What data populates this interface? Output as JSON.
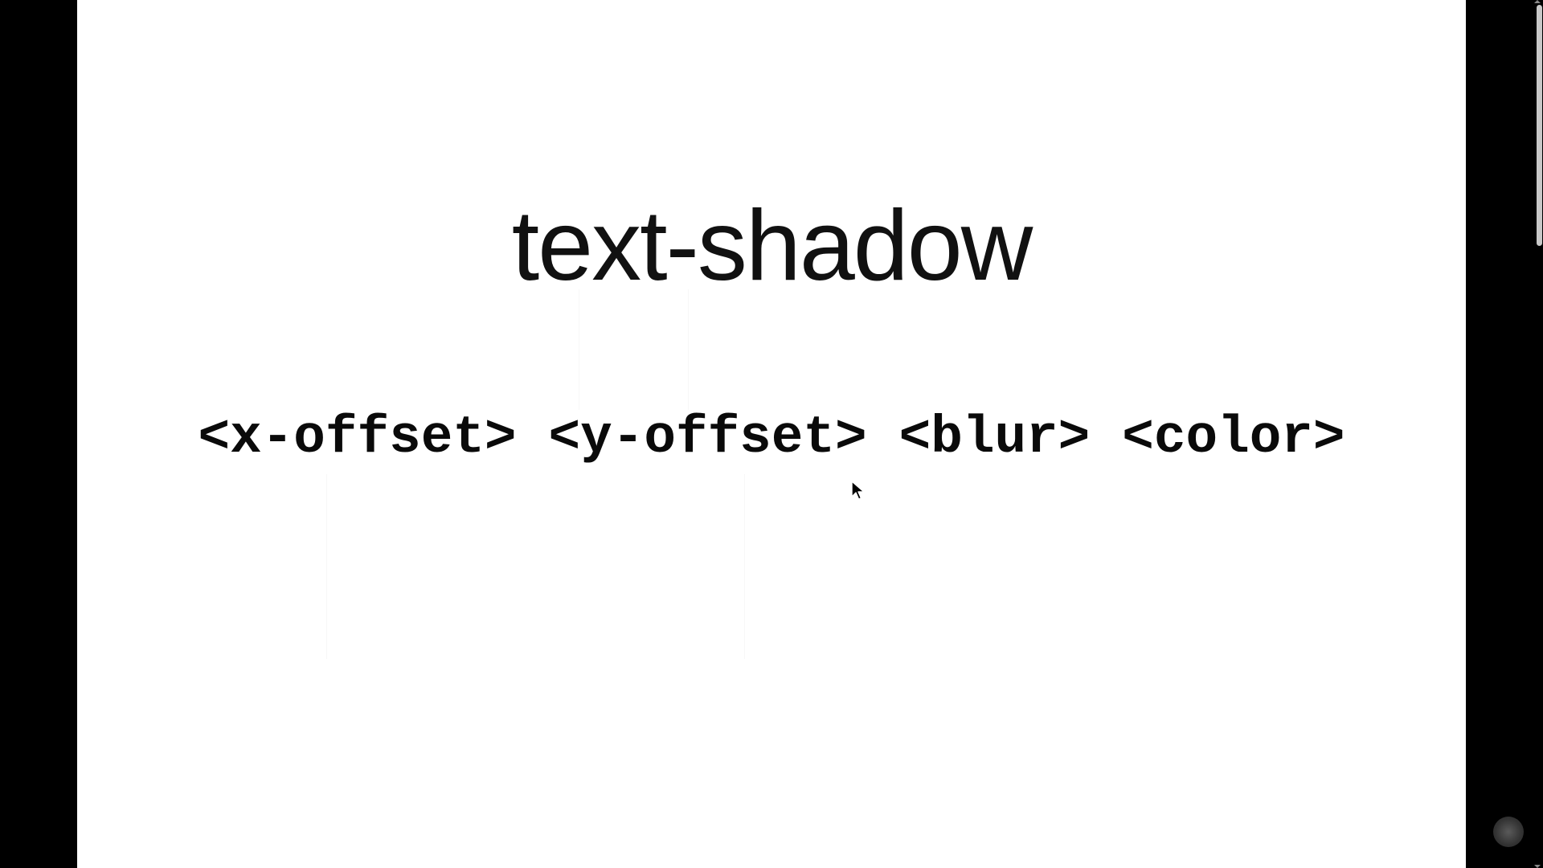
{
  "slide": {
    "title": "text-shadow",
    "syntax": {
      "x_offset": "<x-offset>",
      "y_offset": "<y-offset>",
      "blur": "<blur>",
      "color": "<color>"
    }
  },
  "colors": {
    "background": "#ffffff",
    "letterbox": "#000000",
    "text": "#111111"
  },
  "icons": {
    "cursor": "arrow-cursor-icon",
    "logo": "watermark-logo-icon"
  }
}
